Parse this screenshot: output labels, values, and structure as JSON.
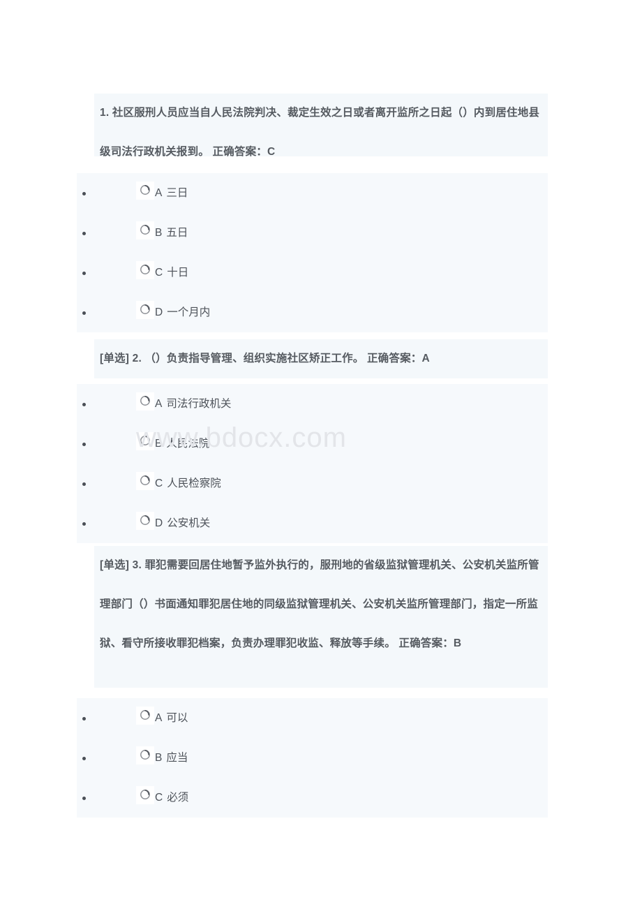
{
  "document": {
    "watermark": "www.bdocx.com",
    "colors": {
      "page_background": "#ffffff",
      "question_block_background": "#f4f8fb",
      "option_block_background": "#f6f9fc",
      "question_text": "#555a60",
      "option_text": "#4d5259",
      "watermark_text": "#e3e5e9"
    }
  },
  "questions": [
    {
      "stem": "1. 社区服刑人员应当自人民法院判决、裁定生效之日或者离开监所之日起（）内到居住地县级司法行政机关报到。 正确答案：C",
      "options": [
        {
          "letter": "A",
          "text": "三日"
        },
        {
          "letter": "B",
          "text": "五日"
        },
        {
          "letter": "C",
          "text": "十日"
        },
        {
          "letter": "D",
          "text": "一个月内"
        }
      ]
    },
    {
      "stem": "[单选] 2. （）负责指导管理、组织实施社区矫正工作。 正确答案：A",
      "options": [
        {
          "letter": "A",
          "text": "司法行政机关"
        },
        {
          "letter": "B",
          "text": "人民法院"
        },
        {
          "letter": "C",
          "text": "人民检察院"
        },
        {
          "letter": "D",
          "text": "公安机关"
        }
      ]
    },
    {
      "stem": "[单选] 3. 罪犯需要回居住地暂予监外执行的，服刑地的省级监狱管理机关、公安机关监所管理部门（）书面通知罪犯居住地的同级监狱管理机关、公安机关监所管理部门，指定一所监狱、看守所接收罪犯档案，负责办理罪犯收监、释放等手续。 正确答案：B",
      "options": [
        {
          "letter": "A",
          "text": "可以"
        },
        {
          "letter": "B",
          "text": "应当"
        },
        {
          "letter": "C",
          "text": "必须"
        }
      ]
    }
  ]
}
